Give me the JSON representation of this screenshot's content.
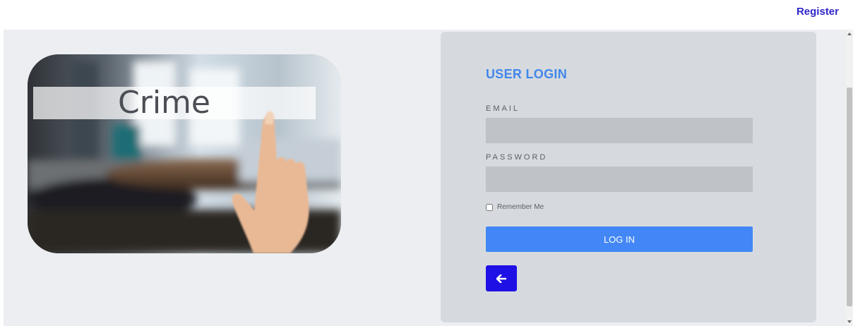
{
  "header": {
    "register_label": "Register"
  },
  "hero": {
    "caption": "Crime"
  },
  "login": {
    "title": "USER LOGIN",
    "email_label": "EMAIL",
    "email_value": "",
    "password_label": "PASSWORD",
    "password_value": "",
    "remember_label": "Remember Me",
    "remember_checked": false,
    "login_button_label": "LOG IN"
  },
  "icons": {
    "back": "arrow-left-icon"
  },
  "colors": {
    "accent": "#4287f5",
    "title": "#4287ea",
    "register_link": "#2f27c8",
    "back_button": "#1f10e6",
    "card_background": "#d6dade",
    "page_background": "#eceef2"
  }
}
